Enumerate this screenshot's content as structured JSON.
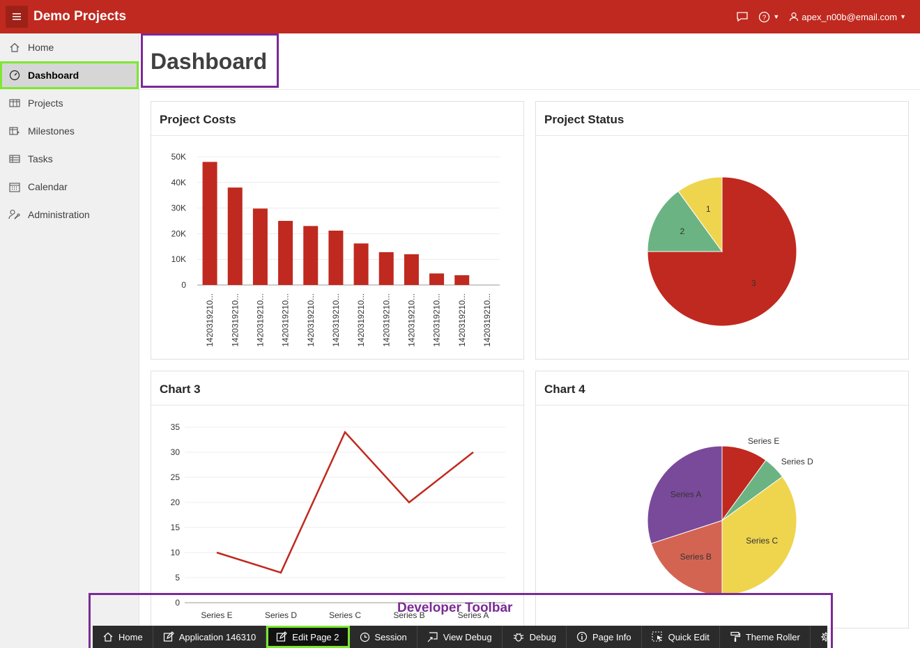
{
  "header": {
    "app_title": "Demo Projects",
    "user": "apex_n00b@email.com",
    "brand_color": "#c0291f"
  },
  "sidebar": {
    "items": [
      {
        "label": "Home",
        "icon": "home-icon"
      },
      {
        "label": "Dashboard",
        "icon": "dashboard-gauge-icon",
        "active": true
      },
      {
        "label": "Projects",
        "icon": "table-icon"
      },
      {
        "label": "Milestones",
        "icon": "milestones-icon"
      },
      {
        "label": "Tasks",
        "icon": "list-table-icon"
      },
      {
        "label": "Calendar",
        "icon": "calendar-icon"
      },
      {
        "label": "Administration",
        "icon": "user-wrench-icon"
      }
    ]
  },
  "page": {
    "title": "Dashboard"
  },
  "regions": {
    "r1": "Project Costs",
    "r2": "Project Status",
    "r3": "Chart 3",
    "r4": "Chart 4"
  },
  "chart_data": [
    {
      "type": "bar",
      "title": "Project Costs",
      "categories": [
        "1420319210...",
        "1420319210...",
        "1420319210...",
        "1420319210...",
        "1420319210...",
        "1420319210...",
        "1420319210...",
        "1420319210...",
        "1420319210...",
        "1420319210...",
        "1420319210...",
        "1420319210..."
      ],
      "values": [
        48000,
        38000,
        29800,
        25000,
        23000,
        21200,
        16200,
        12800,
        12000,
        4500,
        3800,
        0
      ],
      "ylim": [
        0,
        50000
      ],
      "yticks": [
        "0",
        "10K",
        "20K",
        "30K",
        "40K",
        "50K"
      ],
      "color": "#c0291f"
    },
    {
      "type": "pie",
      "title": "Project Status",
      "labels": [
        "3",
        "2",
        "1"
      ],
      "values": [
        75,
        15,
        10
      ],
      "colors": [
        "#c0291f",
        "#6bb383",
        "#efd44e"
      ]
    },
    {
      "type": "line",
      "title": "Chart 3",
      "categories": [
        "Series E",
        "Series D",
        "Series C",
        "Series B",
        "Series A"
      ],
      "values": [
        10,
        6,
        34,
        20,
        30
      ],
      "ylim": [
        0,
        35
      ],
      "yticks": [
        "0",
        "5",
        "10",
        "15",
        "20",
        "25",
        "30",
        "35"
      ],
      "color": "#c0291f"
    },
    {
      "type": "pie",
      "title": "Chart 4",
      "labels": [
        "Series E",
        "Series D",
        "Series C",
        "Series B",
        "Series A"
      ],
      "values": [
        10,
        5,
        35,
        20,
        30
      ],
      "colors": [
        "#c0291f",
        "#6bb383",
        "#efd44e",
        "#d46452",
        "#7a4a9a"
      ]
    }
  ],
  "devbar": {
    "label": "Developer Toolbar",
    "items": [
      {
        "label": "Home",
        "icon": "home-icon"
      },
      {
        "label": "Application 146310",
        "icon": "edit-icon"
      },
      {
        "label": "Edit Page 2",
        "icon": "edit-icon",
        "active": true
      },
      {
        "label": "Session",
        "icon": "clock-icon"
      },
      {
        "label": "View Debug",
        "icon": "view-debug-icon"
      },
      {
        "label": "Debug",
        "icon": "bug-icon"
      },
      {
        "label": "Page Info",
        "icon": "info-icon"
      },
      {
        "label": "Quick Edit",
        "icon": "quick-edit-icon"
      },
      {
        "label": "Theme Roller",
        "icon": "paint-roller-icon"
      },
      {
        "label": "",
        "icon": "gear-icon"
      }
    ]
  }
}
